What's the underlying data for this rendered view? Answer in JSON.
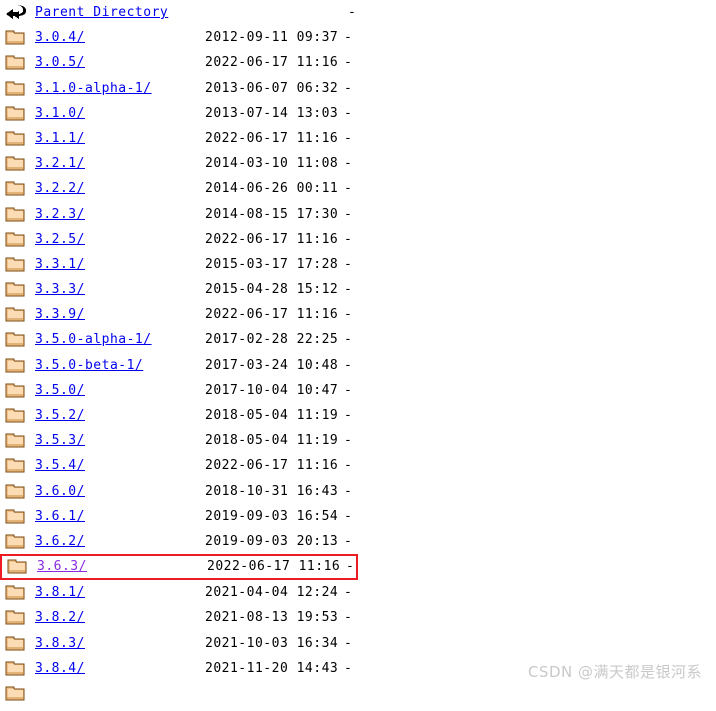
{
  "page": {
    "background_color": "#ffffff",
    "link_color": "#0000ee",
    "visited_link_color": "#8a2be2",
    "highlight_border_color": "#ed1c24",
    "text_color": "#000000"
  },
  "listing": {
    "parent": {
      "icon": "back-arrow-icon",
      "name": "Parent Directory",
      "date": "",
      "size": "-"
    },
    "rows": [
      {
        "icon": "folder-icon",
        "name": "3.0.4/",
        "date": "2012-09-11 09:37",
        "size": "-",
        "visited": false,
        "highlighted": false
      },
      {
        "icon": "folder-icon",
        "name": "3.0.5/",
        "date": "2022-06-17 11:16",
        "size": "-",
        "visited": false,
        "highlighted": false
      },
      {
        "icon": "folder-icon",
        "name": "3.1.0-alpha-1/",
        "date": "2013-06-07 06:32",
        "size": "-",
        "visited": false,
        "highlighted": false
      },
      {
        "icon": "folder-icon",
        "name": "3.1.0/",
        "date": "2013-07-14 13:03",
        "size": "-",
        "visited": false,
        "highlighted": false
      },
      {
        "icon": "folder-icon",
        "name": "3.1.1/",
        "date": "2022-06-17 11:16",
        "size": "-",
        "visited": false,
        "highlighted": false
      },
      {
        "icon": "folder-icon",
        "name": "3.2.1/",
        "date": "2014-03-10 11:08",
        "size": "-",
        "visited": false,
        "highlighted": false
      },
      {
        "icon": "folder-icon",
        "name": "3.2.2/",
        "date": "2014-06-26 00:11",
        "size": "-",
        "visited": false,
        "highlighted": false
      },
      {
        "icon": "folder-icon",
        "name": "3.2.3/",
        "date": "2014-08-15 17:30",
        "size": "-",
        "visited": false,
        "highlighted": false
      },
      {
        "icon": "folder-icon",
        "name": "3.2.5/",
        "date": "2022-06-17 11:16",
        "size": "-",
        "visited": false,
        "highlighted": false
      },
      {
        "icon": "folder-icon",
        "name": "3.3.1/",
        "date": "2015-03-17 17:28",
        "size": "-",
        "visited": false,
        "highlighted": false
      },
      {
        "icon": "folder-icon",
        "name": "3.3.3/",
        "date": "2015-04-28 15:12",
        "size": "-",
        "visited": false,
        "highlighted": false
      },
      {
        "icon": "folder-icon",
        "name": "3.3.9/",
        "date": "2022-06-17 11:16",
        "size": "-",
        "visited": false,
        "highlighted": false
      },
      {
        "icon": "folder-icon",
        "name": "3.5.0-alpha-1/",
        "date": "2017-02-28 22:25",
        "size": "-",
        "visited": false,
        "highlighted": false
      },
      {
        "icon": "folder-icon",
        "name": "3.5.0-beta-1/",
        "date": "2017-03-24 10:48",
        "size": "-",
        "visited": false,
        "highlighted": false
      },
      {
        "icon": "folder-icon",
        "name": "3.5.0/",
        "date": "2017-10-04 10:47",
        "size": "-",
        "visited": false,
        "highlighted": false
      },
      {
        "icon": "folder-icon",
        "name": "3.5.2/",
        "date": "2018-05-04 11:19",
        "size": "-",
        "visited": false,
        "highlighted": false
      },
      {
        "icon": "folder-icon",
        "name": "3.5.3/",
        "date": "2018-05-04 11:19",
        "size": "-",
        "visited": false,
        "highlighted": false
      },
      {
        "icon": "folder-icon",
        "name": "3.5.4/",
        "date": "2022-06-17 11:16",
        "size": "-",
        "visited": false,
        "highlighted": false
      },
      {
        "icon": "folder-icon",
        "name": "3.6.0/",
        "date": "2018-10-31 16:43",
        "size": "-",
        "visited": false,
        "highlighted": false
      },
      {
        "icon": "folder-icon",
        "name": "3.6.1/",
        "date": "2019-09-03 16:54",
        "size": "-",
        "visited": false,
        "highlighted": false
      },
      {
        "icon": "folder-icon",
        "name": "3.6.2/",
        "date": "2019-09-03 20:13",
        "size": "-",
        "visited": false,
        "highlighted": false
      },
      {
        "icon": "folder-icon",
        "name": "3.6.3/",
        "date": "2022-06-17 11:16",
        "size": "-",
        "visited": true,
        "highlighted": true
      },
      {
        "icon": "folder-icon",
        "name": "3.8.1/",
        "date": "2021-04-04 12:24",
        "size": "-",
        "visited": false,
        "highlighted": false
      },
      {
        "icon": "folder-icon",
        "name": "3.8.2/",
        "date": "2021-08-13 19:53",
        "size": "-",
        "visited": false,
        "highlighted": false
      },
      {
        "icon": "folder-icon",
        "name": "3.8.3/",
        "date": "2021-10-03 16:34",
        "size": "-",
        "visited": false,
        "highlighted": false
      },
      {
        "icon": "folder-icon",
        "name": "3.8.4/",
        "date": "2021-11-20 14:43",
        "size": "-",
        "visited": false,
        "highlighted": false
      },
      {
        "icon": "folder-icon",
        "name": "",
        "date": "",
        "size": "",
        "visited": false,
        "highlighted": false
      }
    ]
  },
  "watermark": {
    "text": "CSDN @满天都是银河系"
  }
}
